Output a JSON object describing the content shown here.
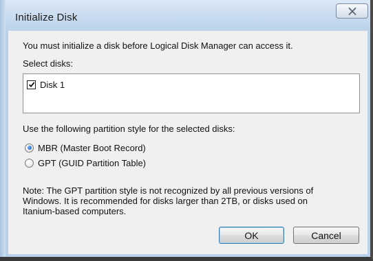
{
  "window": {
    "title": "Initialize Disk",
    "close_icon": "close-icon"
  },
  "content": {
    "intro": "You must initialize a disk before Logical Disk Manager can access it.",
    "select_label": "Select disks:",
    "disks": [
      {
        "label": "Disk 1",
        "checked": true
      }
    ],
    "partition_prompt": "Use the following partition style for the selected disks:",
    "partition_options": [
      {
        "label": "MBR (Master Boot Record)",
        "selected": true
      },
      {
        "label": "GPT (GUID Partition Table)",
        "selected": false
      }
    ],
    "note_lines": [
      "Note: The GPT partition style is not recognized by all previous versions of",
      "Windows. It is recommended for disks larger than 2TB, or disks used on",
      "Itanium-based computers."
    ]
  },
  "buttons": {
    "ok": "OK",
    "cancel": "Cancel"
  }
}
